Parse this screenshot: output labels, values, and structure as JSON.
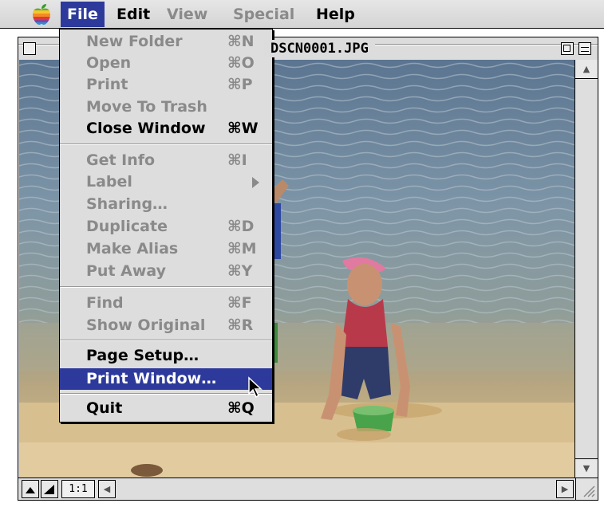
{
  "menubar": {
    "items": [
      {
        "label": "File",
        "state": "active"
      },
      {
        "label": "Edit",
        "state": "enabled"
      },
      {
        "label": "View",
        "state": "disabled"
      },
      {
        "label": "Special",
        "state": "disabled"
      },
      {
        "label": "Help",
        "state": "enabled"
      }
    ]
  },
  "window": {
    "title": "DSCN0001.JPG",
    "zoom_label": "1:1"
  },
  "file_menu": {
    "items": [
      {
        "label": "New Folder",
        "shortcut": "⌘N",
        "state": "disabled"
      },
      {
        "label": "Open",
        "shortcut": "⌘O",
        "state": "disabled"
      },
      {
        "label": "Print",
        "shortcut": "⌘P",
        "state": "disabled"
      },
      {
        "label": "Move To Trash",
        "shortcut": "",
        "state": "disabled"
      },
      {
        "label": "Close Window",
        "shortcut": "⌘W",
        "state": "enabled"
      },
      {
        "label": "Get Info",
        "shortcut": "⌘I",
        "state": "disabled"
      },
      {
        "label": "Label",
        "shortcut": "",
        "state": "disabled",
        "submenu": true
      },
      {
        "label": "Sharing…",
        "shortcut": "",
        "state": "disabled"
      },
      {
        "label": "Duplicate",
        "shortcut": "⌘D",
        "state": "disabled"
      },
      {
        "label": "Make Alias",
        "shortcut": "⌘M",
        "state": "disabled"
      },
      {
        "label": "Put Away",
        "shortcut": "⌘Y",
        "state": "disabled"
      },
      {
        "label": "Find",
        "shortcut": "⌘F",
        "state": "disabled"
      },
      {
        "label": "Show Original",
        "shortcut": "⌘R",
        "state": "disabled"
      },
      {
        "label": "Page Setup…",
        "shortcut": "",
        "state": "enabled"
      },
      {
        "label": "Print Window…",
        "shortcut": "",
        "state": "highlighted"
      },
      {
        "label": "Quit",
        "shortcut": "⌘Q",
        "state": "enabled"
      }
    ]
  },
  "icons": {
    "apple_menu": "apple-logo-icon",
    "pointer": "arrow-cursor-icon",
    "submenu": "submenu-arrow-icon"
  },
  "colors": {
    "menu_highlight": "#2d3a9c",
    "disabled_text": "#8a8a8a"
  }
}
